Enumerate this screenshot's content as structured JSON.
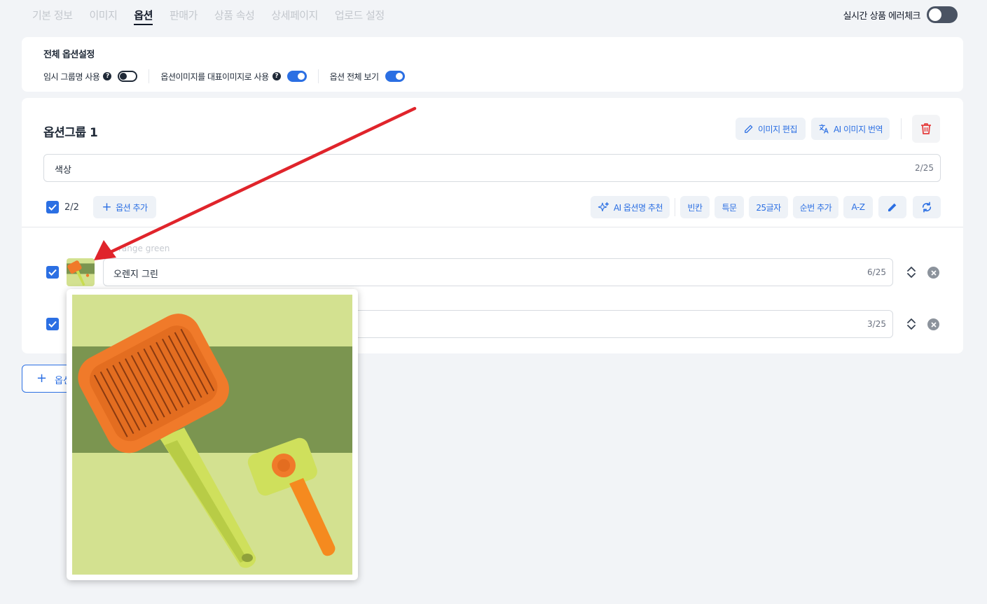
{
  "tabs": [
    "기본 정보",
    "이미지",
    "옵션",
    "판매가",
    "상품 속성",
    "상세페이지",
    "업로드 설정"
  ],
  "active_tab": "옵션",
  "realtime_check": {
    "label": "실시간 상품 에러체크",
    "enabled": false
  },
  "global_settings": {
    "title": "전체 옵션설정",
    "options": [
      {
        "label": "임시 그룹명 사용",
        "help": true,
        "enabled": false
      },
      {
        "label": "옵션이미지를 대표이미지로 사용",
        "help": true,
        "enabled": true
      },
      {
        "label": "옵션 전체 보기",
        "help": false,
        "enabled": true
      }
    ]
  },
  "option_group": {
    "title": "옵션그룹 1",
    "edit_image_label": "이미지 편집",
    "ai_translate_label": "AI 이미지 번역",
    "name_value": "색상",
    "name_counter": "2/25",
    "selected_count": "2/2",
    "add_option_label": "옵션 추가",
    "tools": [
      "AI 옵션명 추천",
      "빈칸",
      "특문",
      "25글자",
      "순번 추가",
      "A-Z"
    ],
    "options": [
      {
        "original": "range green",
        "value": "오렌지 그린",
        "counter": "6/25",
        "checked": true
      },
      {
        "original": "",
        "value": "",
        "counter": "3/25",
        "checked": true
      }
    ]
  },
  "add_group_label": "옵션그룹 추가",
  "colors": {
    "accent": "#2b6fe3",
    "delete": "#e53e3e",
    "annotation_arrow": "#e0242b"
  }
}
